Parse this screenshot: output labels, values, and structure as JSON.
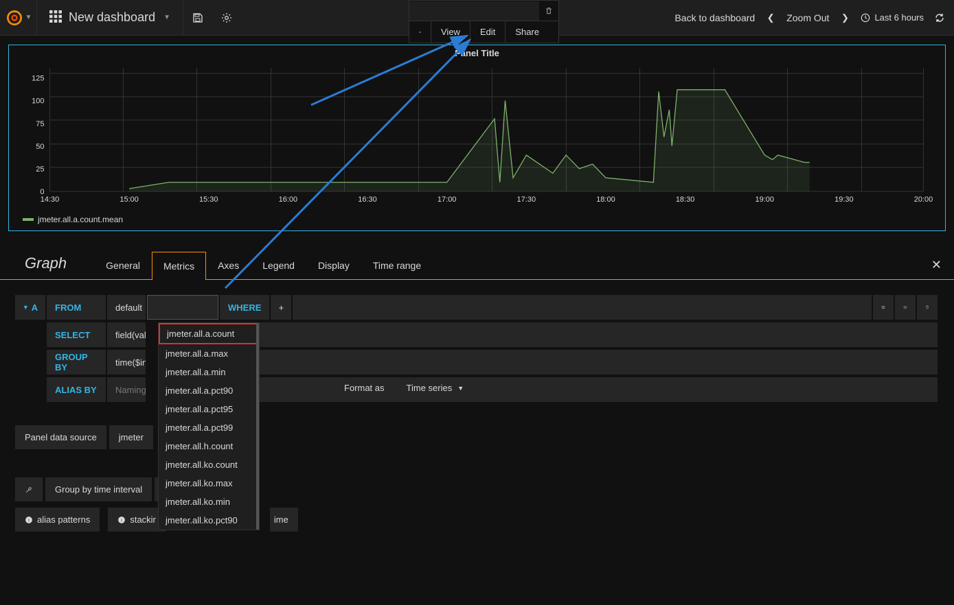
{
  "navbar": {
    "title": "New dashboard",
    "back_label": "Back to dashboard",
    "zoom_label": "Zoom Out",
    "time_label": "Last 6 hours"
  },
  "panel_menu": {
    "view": "View",
    "edit": "Edit",
    "share": "Share"
  },
  "panel": {
    "title": "Panel Title",
    "legend_series": "jmeter.all.a.count.mean"
  },
  "tabs": {
    "graph": "Graph",
    "list": [
      "General",
      "Metrics",
      "Axes",
      "Legend",
      "Display",
      "Time range"
    ],
    "active_index": 1
  },
  "query": {
    "row_letter": "A",
    "from_kw": "FROM",
    "default_rp": "default",
    "where_kw": "WHERE",
    "select_kw": "SELECT",
    "select_val": "field(valu",
    "groupby_kw": "GROUP BY",
    "groupby_val": "time($inte",
    "aliasby_kw": "ALIAS BY",
    "alias_placeholder": "Naming",
    "format_as_label": "Format as",
    "format_as_value": "Time series"
  },
  "measurements": [
    "jmeter.all.a.count",
    "jmeter.all.a.max",
    "jmeter.all.a.min",
    "jmeter.all.a.pct90",
    "jmeter.all.a.pct95",
    "jmeter.all.a.pct99",
    "jmeter.all.h.count",
    "jmeter.all.ko.count",
    "jmeter.all.ko.max",
    "jmeter.all.ko.min",
    "jmeter.all.ko.pct90"
  ],
  "datasource": {
    "label": "Panel data source",
    "value": "jmeter"
  },
  "bottom": {
    "group_interval": "Group by time interval",
    "alias_patterns": "alias patterns",
    "stacking": "stackir",
    "ime": "ime"
  },
  "chart_data": {
    "type": "line",
    "series": [
      {
        "name": "jmeter.all.a.count.mean",
        "color": "#7eb26d",
        "points": [
          {
            "x": "14:30",
            "y": null
          },
          {
            "x": "15:00",
            "y": 3
          },
          {
            "x": "15:15",
            "y": 10
          },
          {
            "x": "15:30",
            "y": 10
          },
          {
            "x": "16:00",
            "y": 10
          },
          {
            "x": "16:30",
            "y": 10
          },
          {
            "x": "17:00",
            "y": 10
          },
          {
            "x": "17:18",
            "y": 80
          },
          {
            "x": "17:20",
            "y": 10
          },
          {
            "x": "17:22",
            "y": 100
          },
          {
            "x": "17:25",
            "y": 15
          },
          {
            "x": "17:30",
            "y": 40
          },
          {
            "x": "17:40",
            "y": 20
          },
          {
            "x": "17:45",
            "y": 40
          },
          {
            "x": "17:50",
            "y": 25
          },
          {
            "x": "17:55",
            "y": 30
          },
          {
            "x": "18:00",
            "y": 15
          },
          {
            "x": "18:18",
            "y": 10
          },
          {
            "x": "18:20",
            "y": 110
          },
          {
            "x": "18:22",
            "y": 60
          },
          {
            "x": "18:24",
            "y": 90
          },
          {
            "x": "18:25",
            "y": 50
          },
          {
            "x": "18:27",
            "y": 112
          },
          {
            "x": "18:45",
            "y": 112
          },
          {
            "x": "19:00",
            "y": 40
          },
          {
            "x": "19:03",
            "y": 35
          },
          {
            "x": "19:05",
            "y": 40
          },
          {
            "x": "19:15",
            "y": 32
          },
          {
            "x": "19:17",
            "y": 32
          }
        ]
      }
    ],
    "title": "Panel Title",
    "x_ticks": [
      "14:30",
      "15:00",
      "15:30",
      "16:00",
      "16:30",
      "17:00",
      "17:30",
      "18:00",
      "18:30",
      "19:00",
      "19:30",
      "20:00"
    ],
    "y_ticks": [
      0,
      25,
      50,
      75,
      100,
      125
    ],
    "ylim": [
      0,
      130
    ],
    "xlabel": "",
    "ylabel": ""
  }
}
